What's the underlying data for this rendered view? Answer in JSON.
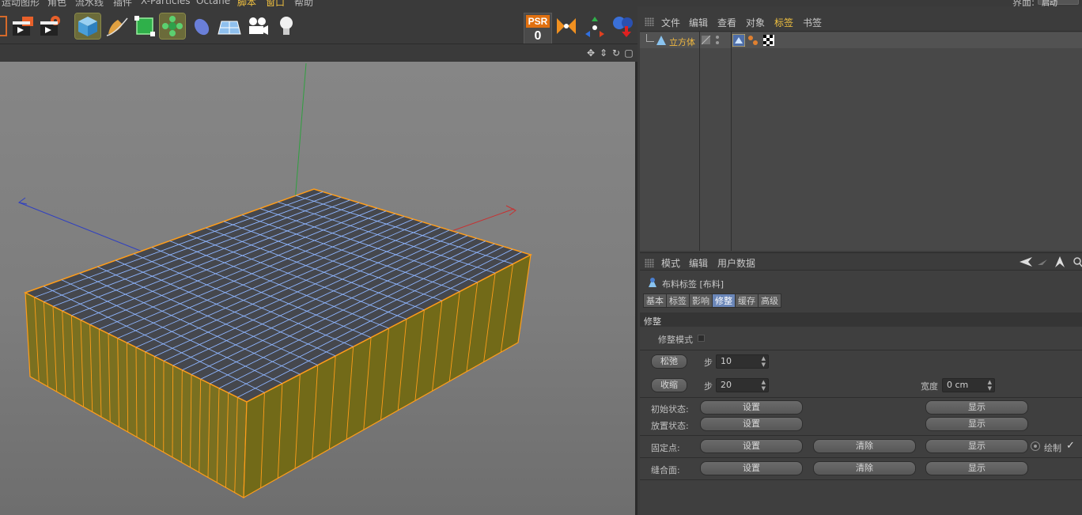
{
  "menubar": {
    "items": [
      "运动图形",
      "角色",
      "流水线",
      "插件",
      "X-Particles",
      "Octane",
      "脚本",
      "窗口",
      "帮助"
    ],
    "layout_label": "界面:",
    "layout_value": "启动"
  },
  "toolbar": {
    "psr_label": "PSR",
    "psr_value": "0",
    "icons": [
      "render-region-icon",
      "render-view-icon",
      "render-settings-icon",
      "cube-icon",
      "pen-icon",
      "subdivision-icon",
      "cloner-icon",
      "deformer-icon",
      "floor-icon",
      "camera-icon",
      "light-icon",
      "snap-icon",
      "quantize-icon",
      "material-icon"
    ]
  },
  "viewport": {
    "nav_icons": [
      "move-icon",
      "zoom-icon",
      "rotate-icon",
      "maximize-icon"
    ],
    "colors": {
      "top_face": "#45474d",
      "grid_line": "#8fb6ff",
      "side_face": "#7a7020",
      "outline": "#ff9d1a",
      "x_axis": "#c83030",
      "y_axis": "#30a040",
      "z_axis": "#3040c0"
    }
  },
  "object_manager": {
    "menu": [
      "文件",
      "编辑",
      "查看",
      "对象",
      "标签",
      "书签"
    ],
    "active_menu": "标签",
    "object_name": "立方体"
  },
  "attribute_manager": {
    "menu": [
      "模式",
      "编辑",
      "用户数据"
    ],
    "title": "布料标签 [布料]",
    "tabs": [
      "基本",
      "标签",
      "影响",
      "修整",
      "缓存",
      "高级"
    ],
    "active_tab": "修整",
    "section": "修整",
    "dress_mode_label": "修整模式",
    "relax_button": "松弛",
    "relax_steps_label": "步",
    "relax_steps_value": "10",
    "shrink_button": "收缩",
    "shrink_steps_label": "步",
    "shrink_steps_value": "20",
    "width_label": "宽度",
    "width_value": "0 cm",
    "init_state_label": "初始状态:",
    "dress_state_label": "放置状态:",
    "fix_points_label": "固定点:",
    "seam_polys_label": "缝合面:",
    "set_label": "设置",
    "clear_label": "清除",
    "show_label": "显示",
    "draw_label": "绘制",
    "draw_check": "✓"
  }
}
